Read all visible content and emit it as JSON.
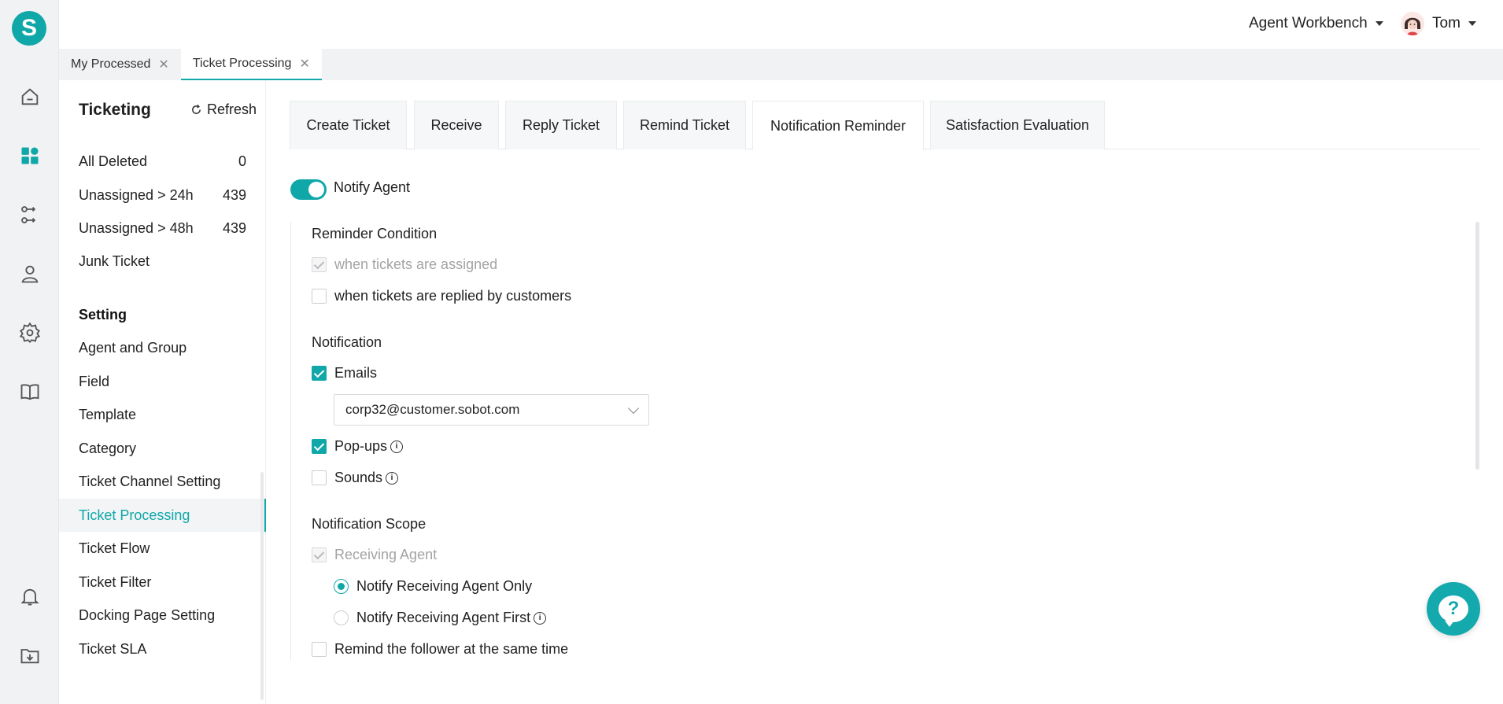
{
  "brand": {
    "logo_letter": "S",
    "accent": "#10a7a8"
  },
  "header": {
    "workbench_label": "Agent Workbench",
    "user_name": "Tom"
  },
  "page_tabs": [
    {
      "label": "My Processed",
      "close": "✕"
    },
    {
      "label": "Ticket Processing",
      "close": "✕"
    }
  ],
  "sidebar": {
    "title": "Ticketing",
    "refresh_label": "Refresh",
    "stats": [
      {
        "label": "All Deleted",
        "count": "0"
      },
      {
        "label": "Unassigned > 24h",
        "count": "439"
      },
      {
        "label": "Unassigned > 48h",
        "count": "439"
      },
      {
        "label": "Junk Ticket",
        "count": ""
      }
    ],
    "section_title": "Setting",
    "settings": [
      {
        "label": "Agent and Group"
      },
      {
        "label": "Field"
      },
      {
        "label": "Template"
      },
      {
        "label": "Category"
      },
      {
        "label": "Ticket Channel Setting"
      },
      {
        "label": "Ticket Processing"
      },
      {
        "label": "Ticket Flow"
      },
      {
        "label": "Ticket Filter"
      },
      {
        "label": "Docking Page Setting"
      },
      {
        "label": "Ticket SLA"
      }
    ]
  },
  "content_tabs": [
    {
      "label": "Create Ticket"
    },
    {
      "label": "Receive"
    },
    {
      "label": "Reply Ticket"
    },
    {
      "label": "Remind Ticket"
    },
    {
      "label": "Notification Reminder"
    },
    {
      "label": "Satisfaction Evaluation"
    }
  ],
  "notify": {
    "toggle_label": "Notify Agent",
    "reminder_condition": {
      "title": "Reminder Condition",
      "options": [
        {
          "label": "when tickets are assigned"
        },
        {
          "label": "when tickets are replied by customers"
        }
      ]
    },
    "notification": {
      "title": "Notification",
      "emails_label": "Emails",
      "email_value": "corp32@customer.sobot.com",
      "popups_label": "Pop-ups",
      "sounds_label": "Sounds"
    },
    "scope": {
      "title": "Notification Scope",
      "receiving_agent_label": "Receiving Agent",
      "radio_only": "Notify Receiving Agent Only",
      "radio_first": "Notify Receiving Agent First",
      "follower_label": "Remind the follower at the same time"
    }
  },
  "help": {
    "glyph": "?"
  },
  "icons": {
    "home": "home-icon",
    "dashboard": "dashboard-icon",
    "routing": "routing-icon",
    "user": "agent-icon",
    "settings": "gear-icon",
    "book": "book-icon",
    "bell": "bell-icon",
    "download": "download-folder-icon",
    "info": "i"
  }
}
